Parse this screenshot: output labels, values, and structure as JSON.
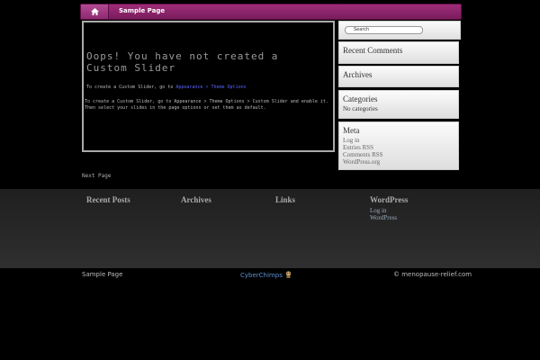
{
  "nav": {
    "home_icon": "home-icon",
    "items": [
      {
        "label": "Sample Page"
      }
    ]
  },
  "post": {
    "title": "Oops! You have not created a Custom Slider",
    "line1_prefix": "To create a Custom Slider, go to ",
    "line1_link": "Appearance > Theme Options",
    "body": "To create a Custom Slider, go to Appearance > Theme Options > Custom Slider and enable it. Then select your slides in the page options or set them as default."
  },
  "post_nav": "Next Page",
  "sidebar": {
    "search_placeholder": "Search",
    "recent_comments_title": "Recent Comments",
    "archives_title": "Archives",
    "categories_title": "Categories",
    "categories_text": "No categories",
    "meta_title": "Meta",
    "meta_links": [
      "Log in",
      "Entries RSS",
      "Comments RSS",
      "WordPress.org"
    ]
  },
  "footer_widgets": {
    "recent_posts_title": "Recent Posts",
    "archives_title": "Archives",
    "links_title": "Links",
    "wordpress_title": "WordPress",
    "wordpress_links": [
      "Log in",
      "WordPress"
    ]
  },
  "footer": {
    "left_link": "Sample Page",
    "logo_text": "CyberChimps",
    "copyright": "© menopause-relief.com"
  }
}
